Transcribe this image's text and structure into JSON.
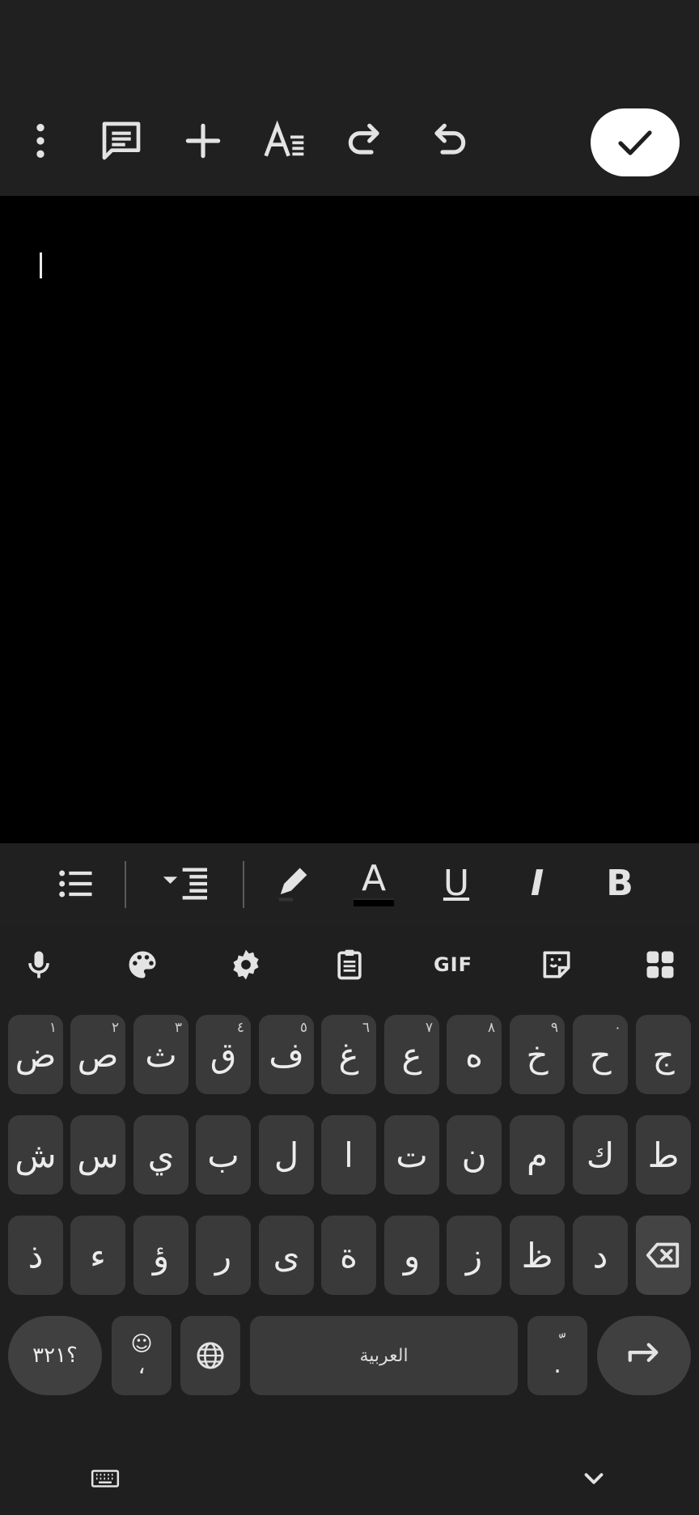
{
  "toolbar": {
    "icons": [
      "more-vert-icon",
      "comment-icon",
      "insert-plus-icon",
      "text-format-icon",
      "redo-icon",
      "undo-icon"
    ],
    "done_icon": "check-icon"
  },
  "format_bar": {
    "items": [
      "bulleted-list-icon",
      "indent-icon",
      "highlight-icon",
      "text-color-icon",
      "underline-icon",
      "italic-icon",
      "bold-icon"
    ],
    "underline_label": "U",
    "italic_label": "I",
    "bold_label": "B",
    "text_color_label": "A",
    "text_color_swatch": "#000000"
  },
  "keyboard_tools": {
    "items": [
      "mic-icon",
      "palette-icon",
      "settings-icon",
      "clipboard-icon",
      "gif-icon",
      "sticker-icon",
      "apps-grid-icon"
    ],
    "gif_label": "GIF"
  },
  "keyboard": {
    "row1": [
      {
        "char": "ض",
        "hint": "١"
      },
      {
        "char": "ص",
        "hint": "٢"
      },
      {
        "char": "ث",
        "hint": "٣"
      },
      {
        "char": "ق",
        "hint": "٤"
      },
      {
        "char": "ف",
        "hint": "٥"
      },
      {
        "char": "غ",
        "hint": "٦"
      },
      {
        "char": "ع",
        "hint": "٧"
      },
      {
        "char": "ه",
        "hint": "٨"
      },
      {
        "char": "خ",
        "hint": "٩"
      },
      {
        "char": "ح",
        "hint": "٠"
      },
      {
        "char": "ج",
        "hint": ""
      }
    ],
    "row2": [
      "ش",
      "س",
      "ي",
      "ب",
      "ل",
      "ا",
      "ت",
      "ن",
      "م",
      "ك",
      "ط"
    ],
    "row3": [
      "ذ",
      "ء",
      "ؤ",
      "ر",
      "ى",
      "ة",
      "و",
      "ز",
      "ظ",
      "د"
    ],
    "symbols_label": "؟٣٢١",
    "comma_label": "،",
    "emoji_label": "☺",
    "space_label": "العربية",
    "period_label": ".",
    "period_hint": "ّ",
    "language_icon": "globe-icon",
    "backspace_icon": "backspace-icon",
    "enter_icon": "enter-arrow-icon"
  },
  "navbar": {
    "keyboard_switch_icon": "keyboard-icon",
    "hide_keyboard_icon": "chevron-down-icon"
  }
}
